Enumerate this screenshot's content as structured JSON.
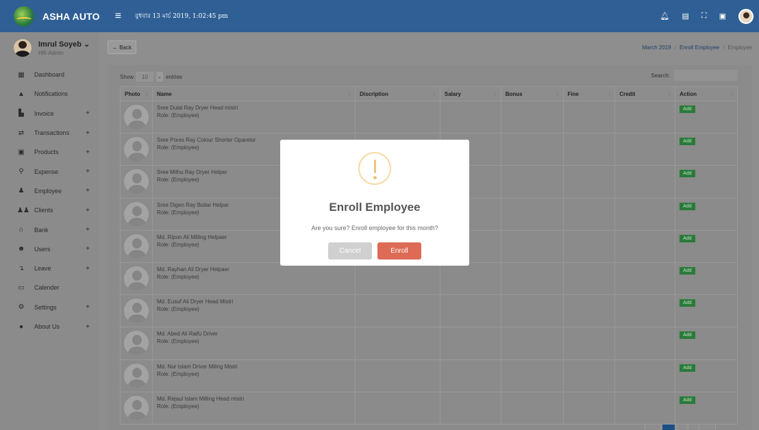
{
  "topbar": {
    "brand": "ASHA AUTO",
    "menu_icon": "hamburger-icon",
    "datetime": "বুধবার 13 মার্চ 2019, 1:02:45 pm",
    "icons": [
      "bell-icon",
      "document-icon",
      "fullscreen-icon",
      "chat-icon",
      "user-avatar"
    ]
  },
  "profile": {
    "name": "Imrul Soyeb ⌄",
    "role": "HR-Admin"
  },
  "sidebar": {
    "items": [
      {
        "label": "Dashboard",
        "icon": "dashboard-icon",
        "expandable": false
      },
      {
        "label": "Notifications",
        "icon": "bell-icon",
        "expandable": false
      },
      {
        "label": "Invoice",
        "icon": "file-icon",
        "expandable": true
      },
      {
        "label": "Transactions",
        "icon": "exchange-icon",
        "expandable": true
      },
      {
        "label": "Products",
        "icon": "box-icon",
        "expandable": true
      },
      {
        "label": "Expense",
        "icon": "expense-icon",
        "expandable": true
      },
      {
        "label": "Employee",
        "icon": "user-icon",
        "expandable": true
      },
      {
        "label": "Clients",
        "icon": "users-icon",
        "expandable": true
      },
      {
        "label": "Bank",
        "icon": "bank-icon",
        "expandable": true
      },
      {
        "label": "Users",
        "icon": "group-icon",
        "expandable": true
      },
      {
        "label": "Leave",
        "icon": "leave-icon",
        "expandable": true
      },
      {
        "label": "Calender",
        "icon": "calendar-icon",
        "expandable": false
      },
      {
        "label": "Settings",
        "icon": "gear-icon",
        "expandable": true
      },
      {
        "label": "About Us",
        "icon": "map-marker-icon",
        "expandable": true
      }
    ],
    "plus": "+"
  },
  "header": {
    "back_label": "← Back",
    "breadcrumb": [
      "March 2019",
      "Enroll Employee",
      "Employee"
    ],
    "sep": "/"
  },
  "table_controls": {
    "show": "Show",
    "entries_value": "10",
    "entries": "entries",
    "search": "Search:"
  },
  "table": {
    "columns": [
      "Photo",
      "Name",
      "Discription",
      "Salary",
      "Bonus",
      "Fine",
      "Credit",
      "Action"
    ],
    "sort_glyph": "↕",
    "rows": [
      {
        "name": "Sree Dulal Ray Dryer Head mistri",
        "role": "Role: (Employee)",
        "action": "Add"
      },
      {
        "name": "Sree Pores Ray Colour Shorter Oparetor",
        "role": "Role: (Employee)",
        "action": "Add"
      },
      {
        "name": "Sree Mithu Ray Dryer Helper",
        "role": "Role: (Employee)",
        "action": "Add"
      },
      {
        "name": "Sree Digen Ray Boilar Helpar",
        "role": "Role: (Employee)",
        "action": "Add"
      },
      {
        "name": "Md. Ripon Ali Milling Helpaer",
        "role": "Role: (Employee)",
        "action": "Add"
      },
      {
        "name": "Md. Rayhan Ali Dryer Helpaer",
        "role": "Role: (Employee)",
        "action": "Add"
      },
      {
        "name": "Md. Eusuf Ali Dryer Head Mistri",
        "role": "Role: (Employee)",
        "action": "Add"
      },
      {
        "name": "Md. Abed Ali Raifu Driver",
        "role": "Role: (Employee)",
        "action": "Add"
      },
      {
        "name": "Md. Nur Islam Driver Miling Mistri",
        "role": "Role: (Employee)",
        "action": "Add"
      },
      {
        "name": "Md. Rejaul Islam Milling Head mistri",
        "role": "Role: (Employee)",
        "action": "Add"
      }
    ]
  },
  "modal": {
    "icon": "warning-icon",
    "title": "Enroll Employee",
    "text": "Are you sure? Enroll employee for this month?",
    "cancel": "Cancel",
    "confirm": "Enroll",
    "confirm_color": "#dd6b55"
  },
  "colors": {
    "topbar": "#2f5f95",
    "add_button": "#2b7a3a"
  }
}
